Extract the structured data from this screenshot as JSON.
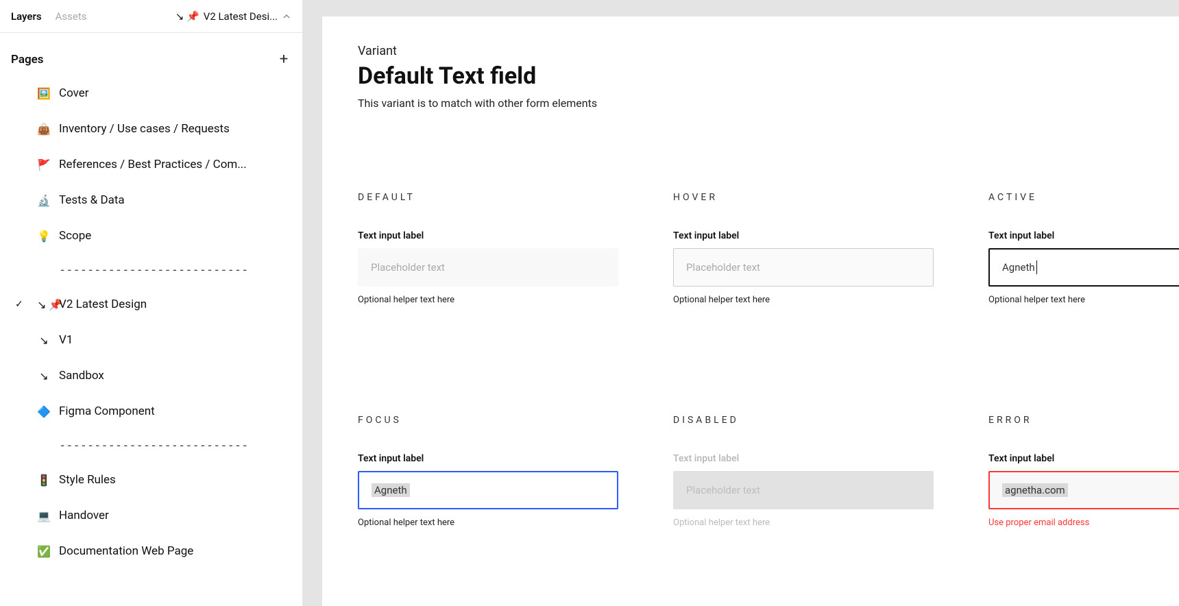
{
  "sidebar": {
    "tabs": {
      "layers": "Layers",
      "assets": "Assets"
    },
    "current_label": "V2 Latest Desi...",
    "current_prefix": "↘ 📌",
    "pages_title": "Pages",
    "items": [
      {
        "emoji": "🖼️",
        "label": "Cover"
      },
      {
        "emoji": "👜",
        "label": "Inventory / Use cases / Requests"
      },
      {
        "emoji": "🚩",
        "label": "References  / Best Practices / Com..."
      },
      {
        "emoji": "🔬",
        "label": "Tests & Data"
      },
      {
        "emoji": "💡",
        "label": "Scope"
      },
      {
        "divider": true,
        "label": "---------------------------"
      },
      {
        "emoji": "↘ 📌",
        "label": "V2  Latest Design",
        "selected": true
      },
      {
        "emoji": "↘",
        "label": "V1"
      },
      {
        "emoji": "↘",
        "label": "Sandbox"
      },
      {
        "emoji": "🔷",
        "label": "Figma Component"
      },
      {
        "divider": true,
        "label": "---------------------------"
      },
      {
        "emoji": "🚦",
        "label": "Style Rules"
      },
      {
        "emoji": "💻",
        "label": "Handover"
      },
      {
        "emoji": "✅",
        "label": "Documentation Web Page"
      }
    ]
  },
  "canvas": {
    "overline": "Variant",
    "title": "Default Text field",
    "description": "This variant is to match with other form elements",
    "states": {
      "default": {
        "name": "DEFAULT",
        "label": "Text input label",
        "placeholder": "Placeholder text",
        "helper": "Optional helper text here"
      },
      "hover": {
        "name": "HOVER",
        "label": "Text input label",
        "placeholder": "Placeholder text",
        "helper": "Optional helper text here"
      },
      "active": {
        "name": "ACTIVE",
        "label": "Text input label",
        "value": "Agneth",
        "helper": "Optional helper text here"
      },
      "focus": {
        "name": "FOCUS",
        "label": "Text input label",
        "value": "Agneth",
        "helper": "Optional helper text here"
      },
      "disabled": {
        "name": "DISABLED",
        "label": "Text input label",
        "placeholder": "Placeholder text",
        "helper": "Optional helper text here"
      },
      "error": {
        "name": "ERROR",
        "label": "Text input label",
        "value": "agnetha.com",
        "helper": "Use proper email address"
      }
    }
  }
}
